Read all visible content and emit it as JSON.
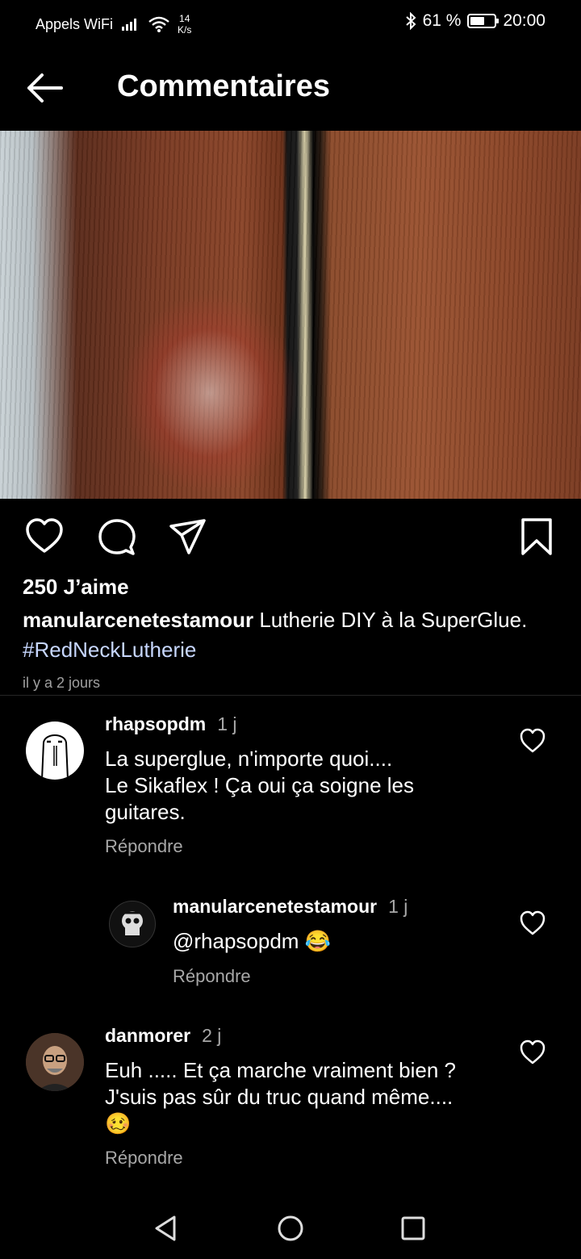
{
  "status_bar": {
    "carrier": "Appels WiFi",
    "speed_value": "14",
    "speed_unit": "K/s",
    "battery": "61 %",
    "battery_level": 0.61,
    "time": "20:00"
  },
  "header": {
    "title": "Commentaires"
  },
  "post": {
    "likes": "250 J’aime",
    "username": "manularcenetestamour",
    "caption": "Lutherie DIY à la SuperGlue.",
    "hashtag": "#RedNeckLutherie",
    "time_ago": "il y a 2 jours"
  },
  "comments": [
    {
      "username": "rhapsopdm",
      "ago": "1 j",
      "lines": [
        "La superglue, n'importe quoi....",
        "Le Sikaflex ! Ça oui ça soigne les",
        "guitares."
      ],
      "reply_label": "Répondre"
    },
    {
      "username": "manularcenetestamour",
      "ago": "1 j",
      "lines": [
        "@rhapsopdm 😂"
      ],
      "reply_label": "Répondre"
    },
    {
      "username": "danmorer",
      "ago": "2 j",
      "lines": [
        "Euh ..... Et ça marche vraiment bien ?",
        "J'suis pas sûr du truc quand même....",
        "🥴"
      ],
      "reply_label": "Répondre"
    }
  ],
  "colors": {
    "background": "#000000",
    "secondary_text": "#a8a8a8",
    "hashtag": "#c7d7ff"
  }
}
